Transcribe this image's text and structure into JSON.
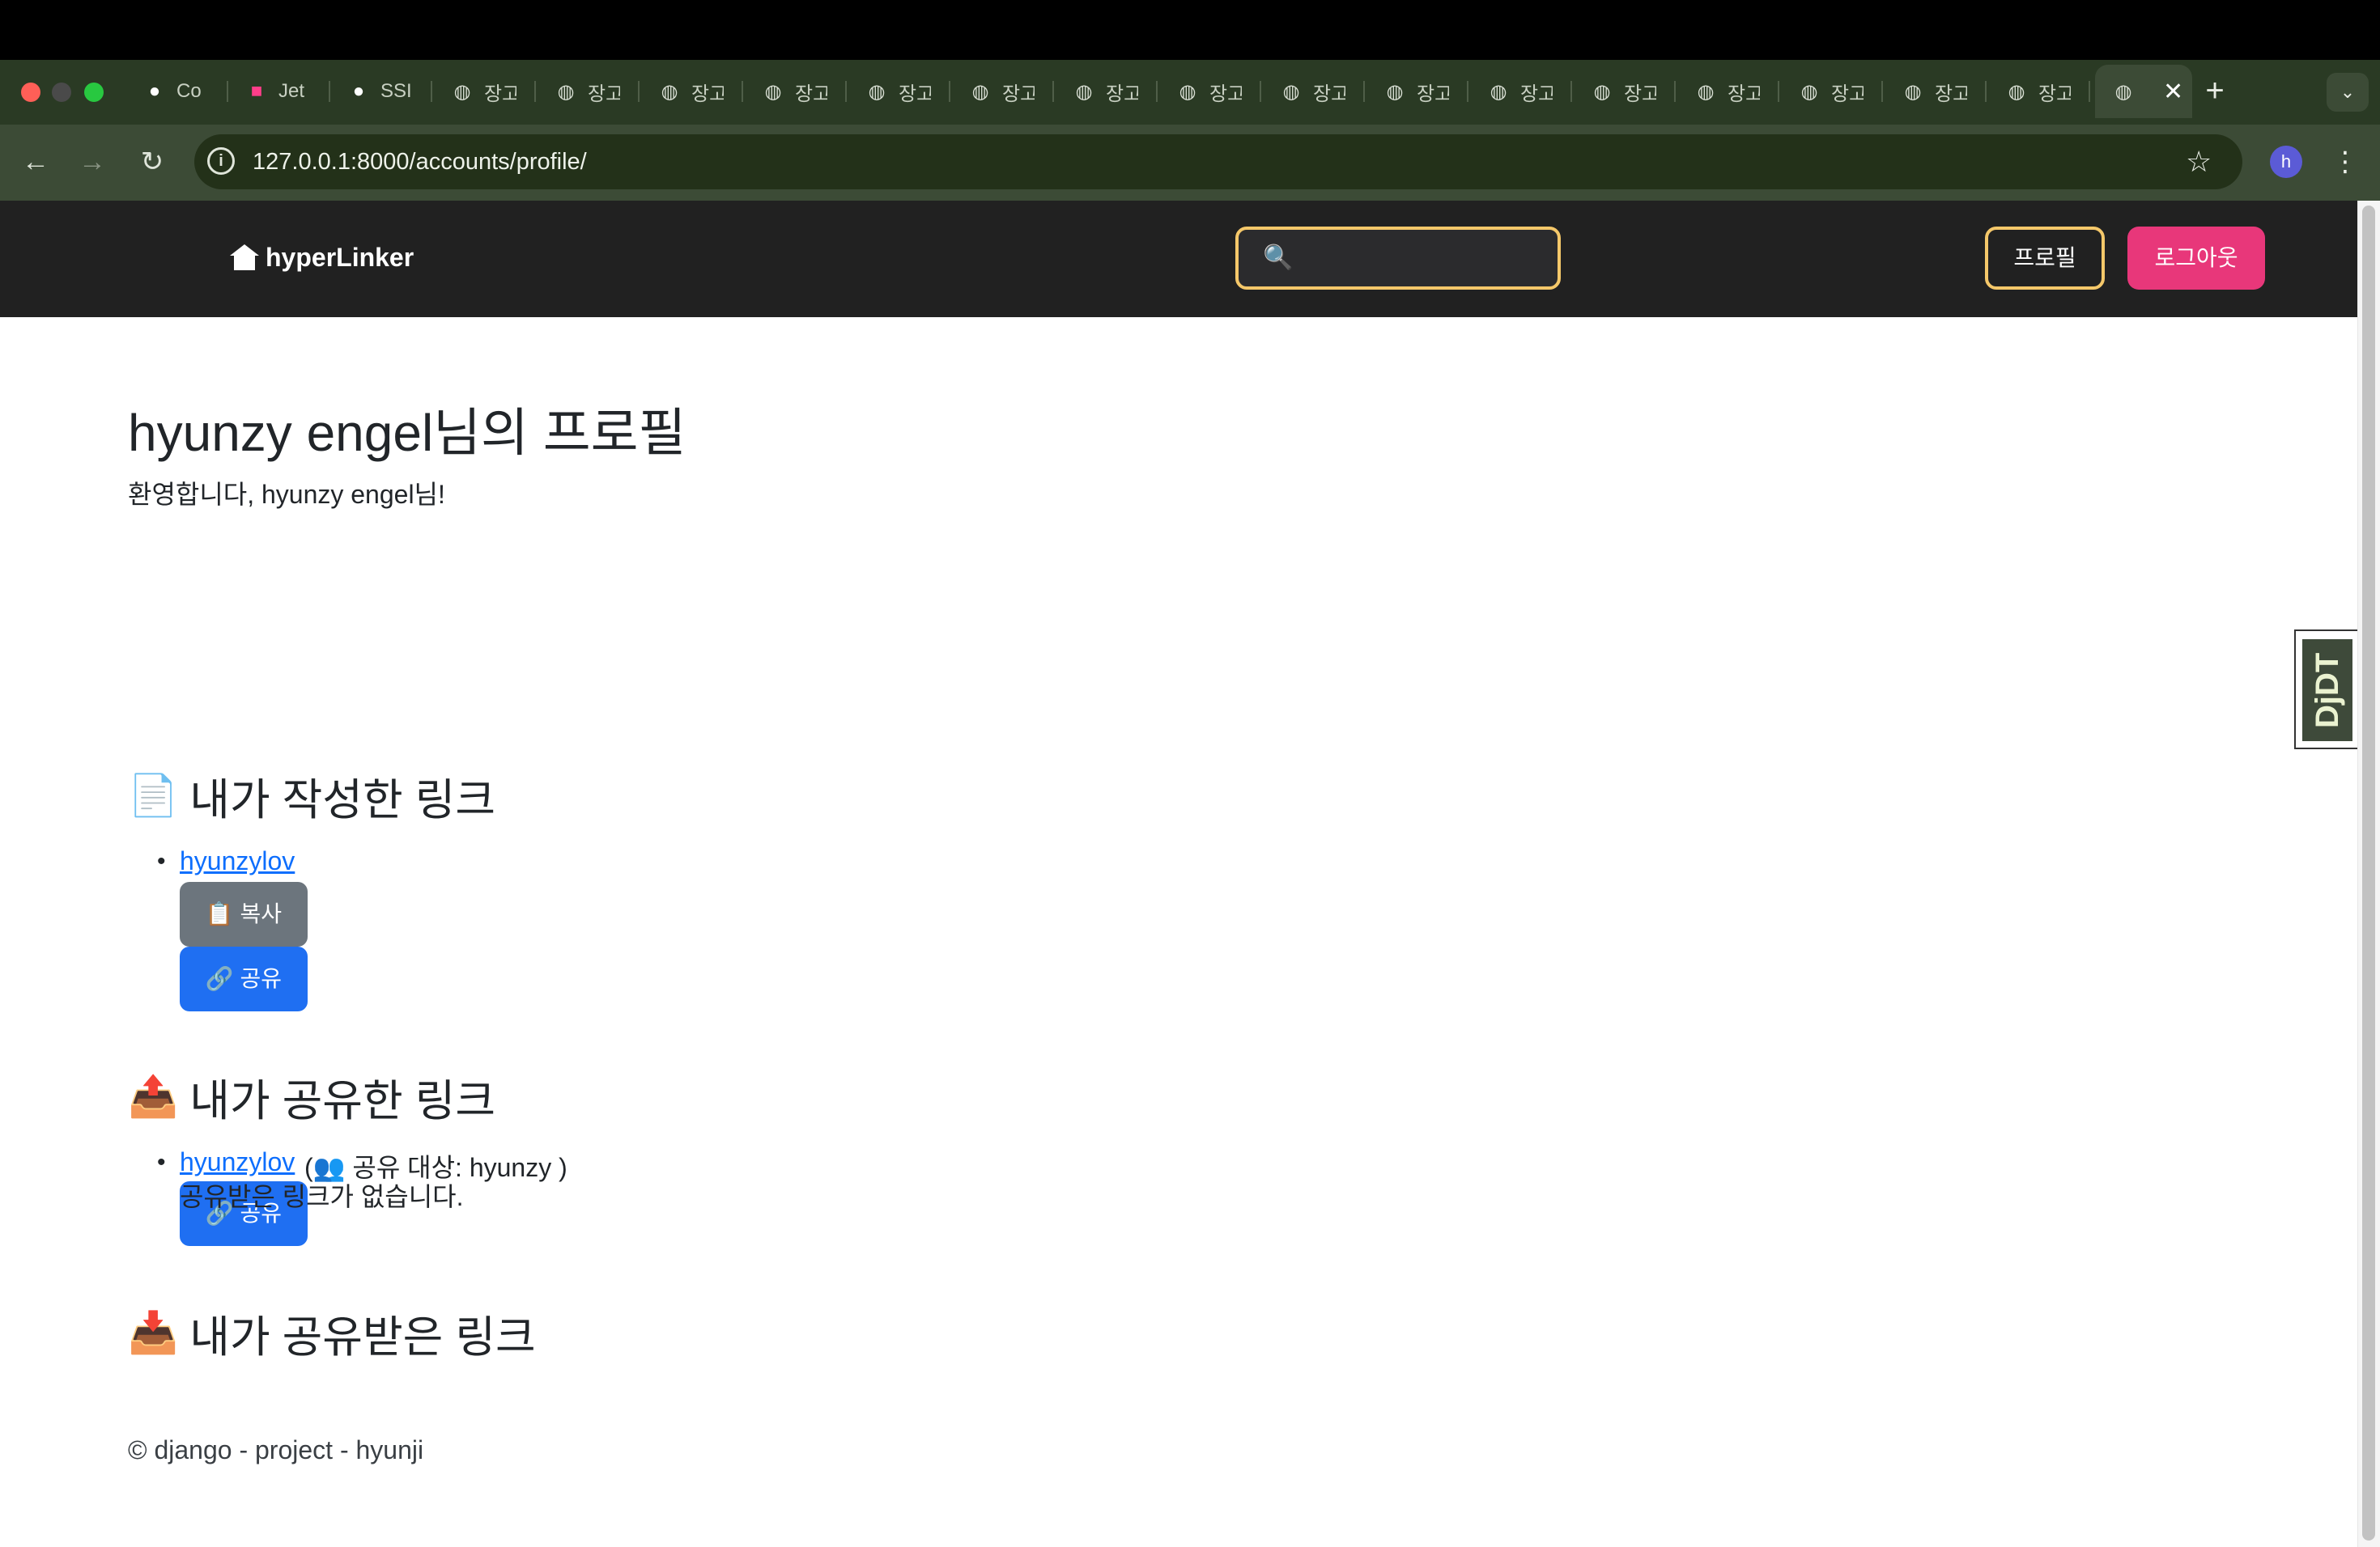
{
  "browser": {
    "tabs": [
      {
        "icon": "github-icon",
        "title": "Co"
      },
      {
        "icon": "jetbrains-icon",
        "title": "Jet"
      },
      {
        "icon": "github-icon",
        "title": "SSI"
      },
      {
        "icon": "globe-icon",
        "title": "장고"
      },
      {
        "icon": "globe-icon",
        "title": "장고"
      },
      {
        "icon": "globe-icon",
        "title": "장고"
      },
      {
        "icon": "globe-icon",
        "title": "장고"
      },
      {
        "icon": "globe-icon",
        "title": "장고"
      },
      {
        "icon": "globe-icon",
        "title": "장고"
      },
      {
        "icon": "globe-icon",
        "title": "장고"
      },
      {
        "icon": "globe-icon",
        "title": "장고"
      },
      {
        "icon": "globe-icon",
        "title": "장고"
      },
      {
        "icon": "globe-icon",
        "title": "장고"
      },
      {
        "icon": "globe-icon",
        "title": "장고"
      },
      {
        "icon": "globe-icon",
        "title": "장고"
      },
      {
        "icon": "globe-icon",
        "title": "장고"
      },
      {
        "icon": "globe-icon",
        "title": "장고"
      },
      {
        "icon": "globe-icon",
        "title": "장고"
      },
      {
        "icon": "globe-icon",
        "title": "장고"
      }
    ],
    "active_tab_close": "✕",
    "new_tab": "+",
    "tab_menu": "⌄",
    "url": "127.0.0.1:8000/accounts/profile/",
    "profile_initial": "h",
    "colors": {
      "chrome_bg": "#3c4b36",
      "tabstrip_bg": "#2a3a24"
    }
  },
  "header": {
    "brand": "hyperLinker",
    "search_placeholder": "🔍",
    "profile_button": "프로필",
    "logout_button": "로그아웃",
    "colors": {
      "bg": "#212121",
      "accent": "#f5c86a",
      "logout": "#e8377a"
    }
  },
  "profile": {
    "title": "hyunzy engel님의 프로필",
    "welcome": "환영합니다, hyunzy engel님!"
  },
  "sections": {
    "my_links": {
      "emoji": "📄",
      "heading": "내가 작성한 링크",
      "items": [
        {
          "link": "hyunzylov",
          "copy_button": "📋 복사",
          "share_button": "🔗 공유"
        }
      ]
    },
    "shared_by_me": {
      "emoji": "📤",
      "heading": "내가 공유한 링크",
      "items": [
        {
          "link": "hyunzylov",
          "note": "(👥 공유 대상: hyunzy )",
          "share_button": "🔗 공유"
        }
      ]
    },
    "shared_with_me": {
      "emoji": "📥",
      "heading": "내가 공유받은 링크",
      "empty": "공유받은 링크가 없습니다."
    }
  },
  "footer": {
    "text": "© django - project - hyunji"
  },
  "debug_toolbar": {
    "label": "DjDT"
  }
}
